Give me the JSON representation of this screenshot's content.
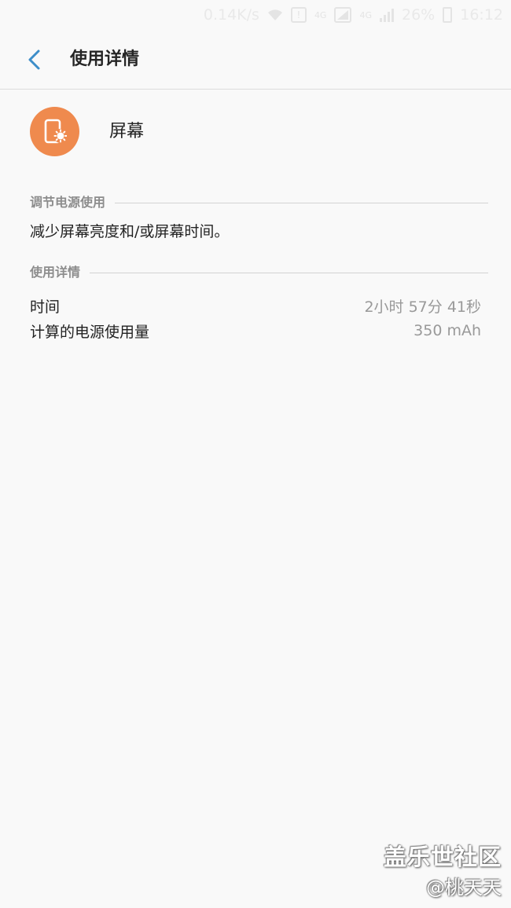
{
  "status_bar": {
    "network_speed": "0.14K/s",
    "wifi_icon": "wifi-icon",
    "notification_icon_text": "!",
    "network_badge_1": "4G",
    "network_badge_2": "4G",
    "battery": "26%",
    "time": "16:12"
  },
  "header": {
    "title": "使用详情",
    "back_icon": "chevron-left-icon",
    "accent_color": "#3d8ec9"
  },
  "app": {
    "name": "屏幕",
    "icon": "screen-brightness-icon",
    "icon_color": "#ef8a4e"
  },
  "sections": {
    "adjust_power": {
      "header": "调节电源使用",
      "text": "减少屏幕亮度和/或屏幕时间。"
    },
    "usage_details": {
      "header": "使用详情",
      "rows": [
        {
          "label": "时间",
          "value": "2小时 57分 41秒"
        },
        {
          "label": "计算的电源使用量",
          "value": "350 mAh"
        }
      ]
    }
  },
  "watermark": {
    "line1": "盖乐世社区",
    "line2": "@桃天天"
  }
}
